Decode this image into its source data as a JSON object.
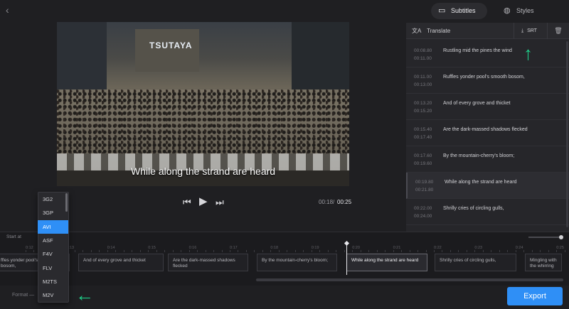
{
  "video": {
    "sign_text": "TSUTAYA",
    "current_subtitle": "While along the strand are heard",
    "time_current": "00:18",
    "time_separator": "/",
    "time_total": "00:25"
  },
  "tabs": [
    {
      "label": "Subtitles",
      "icon": "subtitles-icon"
    },
    {
      "label": "Styles",
      "icon": "palette-icon"
    }
  ],
  "toolbar": {
    "translate_label": "Translate",
    "srt_label": "SRT"
  },
  "subtitles": [
    {
      "start": "00:08.80",
      "end": "00:11.00",
      "text": "Rustling mid the pines the wind"
    },
    {
      "start": "00:11.00",
      "end": "00:13.00",
      "text": "Ruffles yonder pool's smooth bosom,"
    },
    {
      "start": "00:13.20",
      "end": "00:15.20",
      "text": "And of every grove and thicket"
    },
    {
      "start": "00:15.40",
      "end": "00:17.40",
      "text": "Are the dark-massed shadows flecked"
    },
    {
      "start": "00:17.60",
      "end": "00:19.60",
      "text": "By the mountain-cherry's bloom;"
    },
    {
      "start": "00:19.80",
      "end": "00:21.80",
      "text": "While along the strand are heard"
    },
    {
      "start": "00:22.00",
      "end": "00:24.00",
      "text": "Shrilly cries of circling gulls,"
    }
  ],
  "timeline": {
    "start_at_label": "Start at",
    "ticks": [
      "0:12",
      "0:13",
      "0:14",
      "0:15",
      "0:16",
      "0:17",
      "0:18",
      "0:19",
      "0:20",
      "0:21",
      "0:22",
      "0:23",
      "0:24",
      "0:25"
    ],
    "clips": [
      "ffles yonder pool's smooth bosom,",
      "And of every grove and thicket",
      "Are the dark-massed shadows flecked",
      "By the mountain-cherry's bloom;",
      "While along the strand are heard",
      "Shrilly cries of circling gulls,",
      "Mingling with the whirring"
    ]
  },
  "format": {
    "label": "Format —",
    "options": [
      "3G2",
      "3GP",
      "AVI",
      "ASF",
      "F4V",
      "FLV",
      "M2TS",
      "M2V"
    ],
    "selected": "AVI"
  },
  "export_label": "Export",
  "colors": {
    "accent": "#2f8ff6",
    "annotation": "#1fd08a"
  }
}
